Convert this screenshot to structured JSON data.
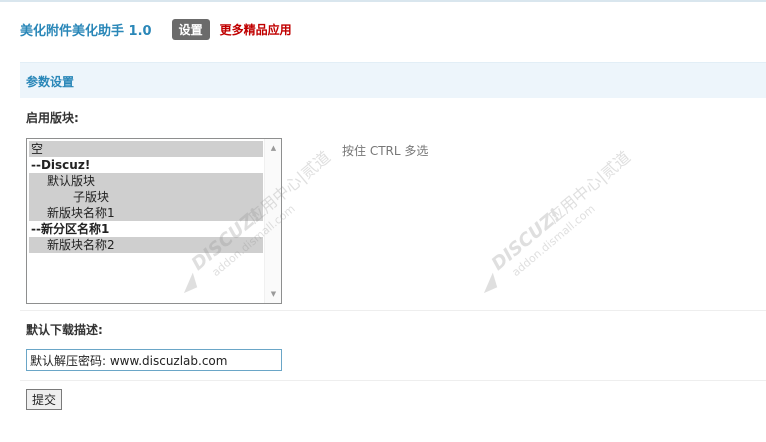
{
  "header": {
    "title": "美化附件美化助手 1.0",
    "tab_settings": "设置",
    "more_apps": "更多精品应用"
  },
  "section": {
    "title": "参数设置"
  },
  "form": {
    "enable_block_label": "启用版块:",
    "block_options": [
      {
        "label": "空",
        "type": "option",
        "selected": true
      },
      {
        "label": "--Discuz!",
        "type": "group",
        "selected": false
      },
      {
        "label": "默认版块",
        "type": "option",
        "selected": true,
        "indent": 1
      },
      {
        "label": "子版块",
        "type": "option",
        "selected": true,
        "indent": 2
      },
      {
        "label": "新版块名称1",
        "type": "option",
        "selected": true,
        "indent": 1
      },
      {
        "label": "--新分区名称1",
        "type": "group",
        "selected": false
      },
      {
        "label": "新版块名称2",
        "type": "option",
        "selected": true,
        "indent": 1
      }
    ],
    "block_hint": "按住 CTRL 多选",
    "download_desc_label": "默认下载描述:",
    "download_desc_value": "默认解压密码: www.discuzlab.com",
    "submit_label": "提交"
  },
  "watermark": {
    "brand": "DISCUZ!",
    "text": "应用中心|贰道",
    "url": "addon.dismall.com"
  },
  "colors": {
    "accent": "#2a87b8",
    "link_red": "#c00000",
    "section_bg": "#edf5fb",
    "selected_bg": "#cfcfcf",
    "input_border": "#6aa6c7"
  }
}
